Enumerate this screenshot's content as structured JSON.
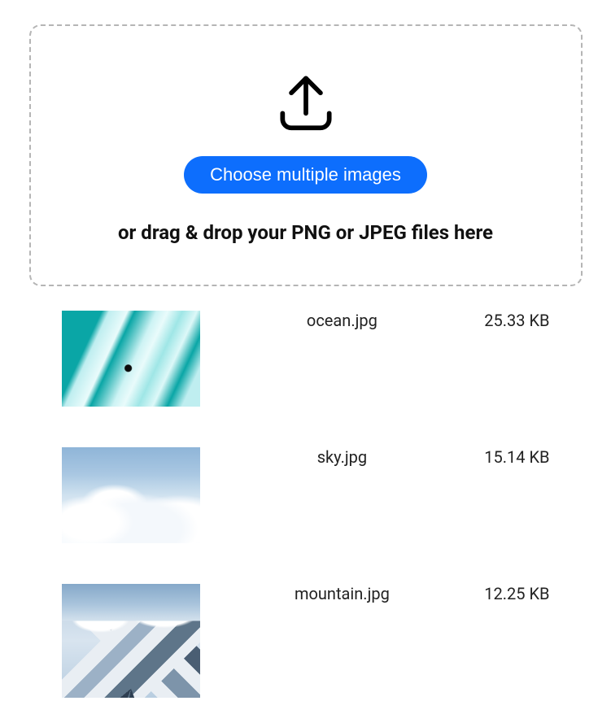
{
  "dropzone": {
    "button_label": "Choose multiple images",
    "hint_text": "or drag & drop your PNG or JPEG files here"
  },
  "files": [
    {
      "name": "ocean.jpg",
      "size": "25.33 KB",
      "thumb_class": "thumb-ocean"
    },
    {
      "name": "sky.jpg",
      "size": "15.14 KB",
      "thumb_class": "thumb-sky"
    },
    {
      "name": "mountain.jpg",
      "size": "12.25 KB",
      "thumb_class": "thumb-mountain"
    }
  ]
}
